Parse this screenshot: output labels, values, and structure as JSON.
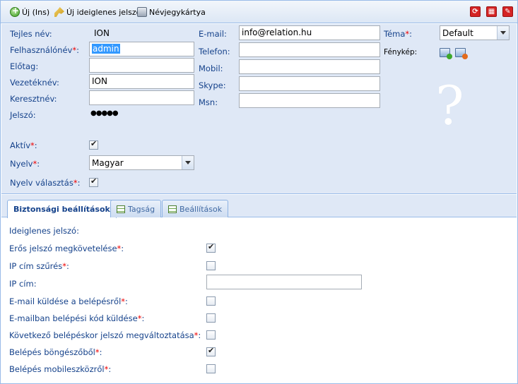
{
  "toolbar": {
    "new_label": "Új (Ins)",
    "temp_password_label": "Új ideiglenes jelszó",
    "business_card_label": "Névjegykártya"
  },
  "form": {
    "full_name_label": "Tejles név:",
    "full_name_value": "ION",
    "username_label": "Felhasználónév",
    "username_value": "admin",
    "prefix_label": "Előtag:",
    "prefix_value": "",
    "lastname_label": "Vezetéknév:",
    "lastname_value": "ION",
    "firstname_label": "Keresztnév:",
    "firstname_value": "",
    "password_label": "Jelszó:",
    "password_value": "●●●●●",
    "email_label": "E-mail:",
    "email_value": "info@relation.hu",
    "phone_label": "Telefon:",
    "phone_value": "",
    "mobile_label": "Mobil:",
    "mobile_value": "",
    "skype_label": "Skype:",
    "skype_value": "",
    "msn_label": "Msn:",
    "msn_value": "",
    "theme_label": "Téma",
    "theme_value": "Default",
    "photo_label": "Fénykép:",
    "photo_placeholder": "?",
    "active_label": "Aktív",
    "active_checked": true,
    "language_label": "Nyelv",
    "language_value": "Magyar",
    "language_select_label": "Nyelv választás",
    "language_select_checked": true
  },
  "tabs": [
    {
      "label": "Biztonsági beállítások",
      "active": true
    },
    {
      "label": "Tagság",
      "active": false
    },
    {
      "label": "Beállítások",
      "active": false
    }
  ],
  "security": {
    "temp_password_label": "Ideiglenes jelszó:",
    "rows": [
      {
        "label": "Erős jelszó megkövetelése",
        "required": true,
        "checked": true
      },
      {
        "label": "IP cím szűrés",
        "required": true,
        "checked": false
      },
      {
        "label": "IP cím:",
        "required": false,
        "input": ""
      },
      {
        "label": "E-mail küldése a belépésről",
        "required": true,
        "checked": false
      },
      {
        "label": "E-mailban belépési kód küldése",
        "required": true,
        "checked": false
      },
      {
        "label": "Következő belépéskor jelszó megváltoztatása",
        "required": true,
        "checked": false
      },
      {
        "label": "Belépés böngészőből",
        "required": true,
        "checked": true
      },
      {
        "label": "Belépés mobileszközről",
        "required": true,
        "checked": false
      }
    ]
  },
  "colors": {
    "label": "#15428b",
    "panel_bg": "#dfe8f6",
    "border": "#99bbe8",
    "required": "#ee0000",
    "window_buttons": "#d42424"
  },
  "icons": {
    "new": "add-icon",
    "temp_password": "key-icon",
    "business_card": "print-icon",
    "window_right": [
      "refresh-icon",
      "table-icon",
      "edit-icon"
    ],
    "photo": [
      "photo-add-icon",
      "photo-remove-icon"
    ],
    "tabs": [
      "table-icon",
      "table-icon"
    ]
  }
}
